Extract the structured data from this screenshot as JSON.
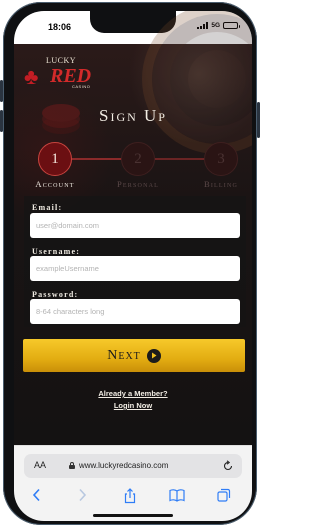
{
  "status_bar": {
    "time": "18:06",
    "network": "5G"
  },
  "brand": {
    "lucky": "LUCKY",
    "red": "RED",
    "casino": "CASINO"
  },
  "page": {
    "title": "Sign Up"
  },
  "steps": [
    {
      "number": "1",
      "label": "Account",
      "active": true
    },
    {
      "number": "2",
      "label": "Personal",
      "active": false
    },
    {
      "number": "3",
      "label": "Billing",
      "active": false
    }
  ],
  "form": {
    "email": {
      "label": "Email:",
      "placeholder": "user@domain.com",
      "value": ""
    },
    "username": {
      "label": "Username:",
      "placeholder": "exampleUsername",
      "value": ""
    },
    "password": {
      "label": "Password:",
      "placeholder": "8-64 characters long",
      "value": ""
    }
  },
  "next_button": {
    "label": "Next"
  },
  "links": {
    "already_member": "Already a Member?",
    "login": "Login Now"
  },
  "browser": {
    "text_size": "AA",
    "url": "www.luckyredcasino.com"
  },
  "colors": {
    "accent_gold": "#e3ad12",
    "accent_red": "#6b0f12",
    "background": "#1a1414"
  },
  "icons": [
    "signal-icon",
    "battery-icon",
    "play-icon",
    "lock-icon",
    "reload-icon",
    "back-icon",
    "forward-icon",
    "share-icon",
    "bookmarks-icon",
    "tabs-icon"
  ]
}
